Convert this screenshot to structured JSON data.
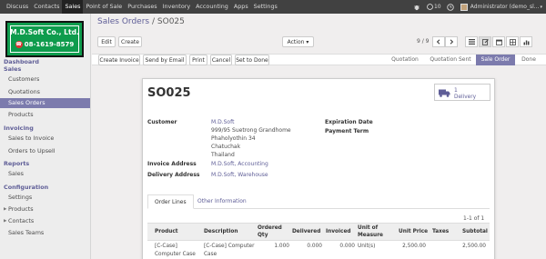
{
  "topmenu": [
    "Discuss",
    "Contacts",
    "Sales",
    "Point of Sale",
    "Purchases",
    "Inventory",
    "Accounting",
    "Apps",
    "Settings"
  ],
  "topbar": {
    "notifications": "10",
    "user": "Administrator (demo_sl..."
  },
  "logo": {
    "company": "M.D.Soft Co., Ltd.",
    "phone": "08-1619-8579"
  },
  "sidebar": {
    "dashboard": "Dashboard",
    "sales_head": "Sales",
    "customers": "Customers",
    "quotations": "Quotations",
    "sales_orders": "Sales Orders",
    "products": "Products",
    "invoicing_head": "Invoicing",
    "sales_to_invoice": "Sales to Invoice",
    "orders_to_upsell": "Orders to Upsell",
    "reports_head": "Reports",
    "reports_sales": "Sales",
    "configuration_head": "Configuration",
    "settings": "Settings",
    "cfg_products": "Products",
    "contacts": "Contacts",
    "sales_teams": "Sales Teams"
  },
  "breadcrumb": {
    "parent": "Sales Orders",
    "separator": "/",
    "current": "SO025"
  },
  "toolbar": {
    "edit": "Edit",
    "create": "Create",
    "action": "Action",
    "pager": "9 / 9"
  },
  "statusbar": {
    "create_invoice": "Create Invoice",
    "send_email": "Send by Email",
    "print": "Print",
    "cancel": "Cancel",
    "set_done": "Set to Done",
    "stages": [
      "Quotation",
      "Quotation Sent",
      "Sale Order",
      "Done"
    ],
    "active_stage": "Sale Order"
  },
  "order": {
    "name": "SO025",
    "delivery_count": "1",
    "delivery_label": "Delivery",
    "customer_label": "Customer",
    "customer_name": "M.D.Soft",
    "address_line1": "999/95 Suetrong Grandhome",
    "address_line2": "Phaholyothin 34",
    "address_line3": "Chatuchak",
    "address_line4": "Thailand",
    "invoice_address_label": "Invoice Address",
    "invoice_address": "M.D.Soft, Accounting",
    "delivery_address_label": "Delivery Address",
    "delivery_address": "M.D.Soft, Warehouse",
    "expiration_label": "Expiration Date",
    "payment_term_label": "Payment Term"
  },
  "tabs": {
    "order_lines": "Order Lines",
    "other_info": "Other Information"
  },
  "lines": {
    "count": "1-1 of 1",
    "headers": {
      "product": "Product",
      "description": "Description",
      "ordered_qty_1": "Ordered",
      "ordered_qty_2": "Qty",
      "delivered": "Delivered",
      "invoiced": "Invoiced",
      "uom_1": "Unit of",
      "uom_2": "Measure",
      "price": "Unit Price",
      "taxes": "Taxes",
      "subtotal": "Subtotal"
    },
    "rows": [
      {
        "product_1": "[C-Case]",
        "product_2": "Computer Case",
        "description_1": "[C-Case] Computer",
        "description_2": "Case",
        "ordered": "1.000",
        "delivered": "0.000",
        "invoiced": "0.000",
        "uom": "Unit(s)",
        "price": "2,500.00",
        "taxes": "",
        "subtotal": "2,500.00"
      }
    ]
  },
  "colors": {
    "topbar": "#414141",
    "accent": "#7c7bad",
    "link": "#5f5e97",
    "logo_green": "#0e9c4d"
  }
}
